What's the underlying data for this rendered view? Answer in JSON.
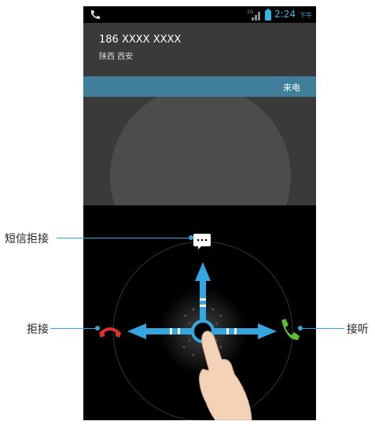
{
  "status": {
    "time": "2:24",
    "ampm": "下午"
  },
  "caller": {
    "number": "186 XXXX XXXX",
    "location": "陕西 西安"
  },
  "incoming_label": "来电",
  "annotations": {
    "sms_reject": "短信拒接",
    "reject": "拒接",
    "answer": "接听"
  },
  "colors": {
    "accent": "#35b6e6",
    "bar": "#3f7f9c",
    "reject": "#e0302b",
    "answer": "#5fbf2d"
  },
  "icons": [
    "phone-icon",
    "signal-icon",
    "battery-icon",
    "message-icon",
    "hang-up-icon",
    "answer-icon",
    "unlock-ring-icon",
    "hand-icon"
  ]
}
